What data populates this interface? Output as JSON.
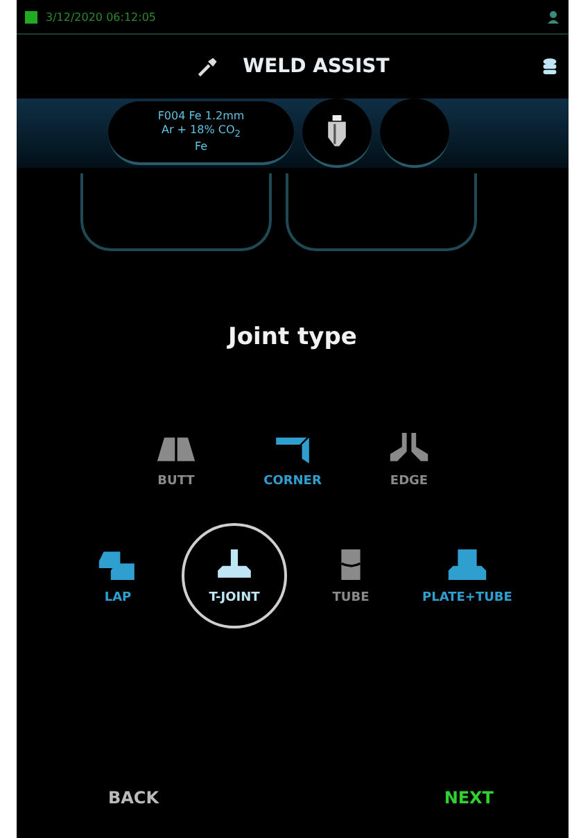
{
  "status_bar": {
    "datetime": "3/12/2020 06:12:05"
  },
  "header": {
    "title": "WELD ASSIST"
  },
  "consumable": {
    "lines": [
      "F004 Fe 1.2mm",
      "Ar + 18% CO$_{2}$",
      "Fe"
    ]
  },
  "heading": "Joint type",
  "joint_rows": [
    [
      {
        "label": "BUTT",
        "kind": "butt",
        "disabled": true,
        "selected": false
      },
      {
        "label": "CORNER",
        "kind": "corner",
        "disabled": false,
        "selected": false
      },
      {
        "label": "EDGE",
        "kind": "edge",
        "disabled": true,
        "selected": false
      }
    ],
    [
      {
        "label": "LAP",
        "kind": "lap",
        "disabled": false,
        "selected": false
      },
      {
        "label": "T-JOINT",
        "kind": "tjoint",
        "disabled": false,
        "selected": true
      },
      {
        "label": "TUBE",
        "kind": "tube",
        "disabled": true,
        "selected": false
      },
      {
        "label": "PLATE+TUBE",
        "kind": "platetube",
        "disabled": false,
        "selected": false
      }
    ]
  ],
  "footer": {
    "back": "BACK",
    "next": "NEXT"
  }
}
